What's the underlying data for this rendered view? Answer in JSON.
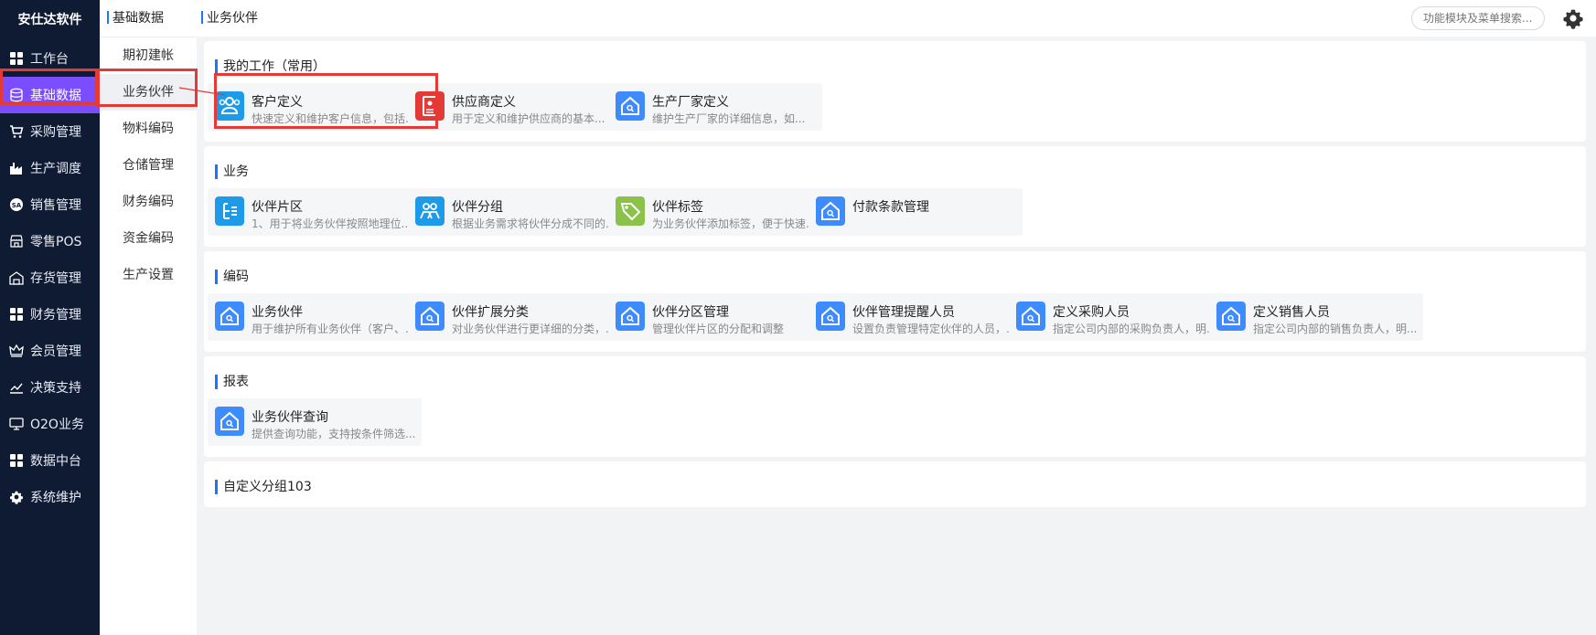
{
  "sidebar": {
    "brand": "安仕达软件",
    "items": [
      {
        "label": "工作台",
        "icon": "grid-icon"
      },
      {
        "label": "基础数据",
        "icon": "database-icon",
        "active": true
      },
      {
        "label": "采购管理",
        "icon": "cart-icon"
      },
      {
        "label": "生产调度",
        "icon": "factory-icon"
      },
      {
        "label": "销售管理",
        "icon": "sale-icon"
      },
      {
        "label": "零售POS",
        "icon": "store-icon"
      },
      {
        "label": "存货管理",
        "icon": "warehouse-icon"
      },
      {
        "label": "财务管理",
        "icon": "grid-icon"
      },
      {
        "label": "会员管理",
        "icon": "crown-icon"
      },
      {
        "label": "决策支持",
        "icon": "chart-icon"
      },
      {
        "label": "O2O业务",
        "icon": "monitor-icon"
      },
      {
        "label": "数据中台",
        "icon": "grid-icon"
      },
      {
        "label": "系统维护",
        "icon": "gear-icon"
      }
    ]
  },
  "submenu": {
    "title": "基础数据",
    "items": [
      "期初建帐",
      "业务伙伴",
      "物料编码",
      "仓储管理",
      "财务编码",
      "资金编码",
      "生产设置"
    ]
  },
  "topbar": {
    "breadcrumb": "业务伙伴",
    "search_placeholder": "功能模块及菜单搜索..."
  },
  "sections": [
    {
      "title": "我的工作（常用）",
      "cards": [
        {
          "title": "客户定义",
          "desc": "快速定义和维护客户信息，包括...",
          "icon": "customer-icon",
          "color": "#1e9be8"
        },
        {
          "title": "供应商定义",
          "desc": "用于定义和维护供应商的基本...",
          "icon": "supplier-icon",
          "color": "#e53935"
        },
        {
          "title": "生产厂家定义",
          "desc": "维护生产厂家的详细信息，如...",
          "icon": "home-search-icon",
          "color": "#3d8bfd"
        }
      ]
    },
    {
      "title": "业务",
      "cards": [
        {
          "title": "伙伴片区",
          "desc": "1、用于将业务伙伴按照地理位...",
          "icon": "list-tree-icon",
          "color": "#1e9be8"
        },
        {
          "title": "伙伴分组",
          "desc": "根据业务需求将伙伴分成不同的...",
          "icon": "group-icon",
          "color": "#1e9be8"
        },
        {
          "title": "伙伴标签",
          "desc": "为业务伙伴添加标签，便于快速...",
          "icon": "tag-icon",
          "color": "#8bc34a"
        },
        {
          "title": "付款条款管理",
          "desc": "",
          "icon": "home-search-icon",
          "color": "#3d8bfd"
        }
      ]
    },
    {
      "title": "编码",
      "cards": [
        {
          "title": "业务伙伴",
          "desc": "用于维护所有业务伙伴（客户、...",
          "icon": "home-search-icon",
          "color": "#3d8bfd"
        },
        {
          "title": "伙伴扩展分类",
          "desc": "对业务伙伴进行更详细的分类，...",
          "icon": "home-search-icon",
          "color": "#3d8bfd"
        },
        {
          "title": "伙伴分区管理",
          "desc": "管理伙伴片区的分配和调整",
          "icon": "home-search-icon",
          "color": "#3d8bfd"
        },
        {
          "title": "伙伴管理提醒人员",
          "desc": "设置负责管理特定伙伴的人员，...",
          "icon": "home-search-icon",
          "color": "#3d8bfd"
        },
        {
          "title": "定义采购人员",
          "desc": "指定公司内部的采购负责人，明...",
          "icon": "home-search-icon",
          "color": "#3d8bfd"
        },
        {
          "title": "定义销售人员",
          "desc": "指定公司内部的销售负责人，明...",
          "icon": "home-search-icon",
          "color": "#3d8bfd"
        }
      ]
    },
    {
      "title": "报表",
      "cards": [
        {
          "title": "业务伙伴查询",
          "desc": "提供查询功能，支持按条件筛选...",
          "icon": "home-search-icon",
          "color": "#3d8bfd"
        }
      ]
    },
    {
      "title": "自定义分组103",
      "cards": []
    }
  ]
}
